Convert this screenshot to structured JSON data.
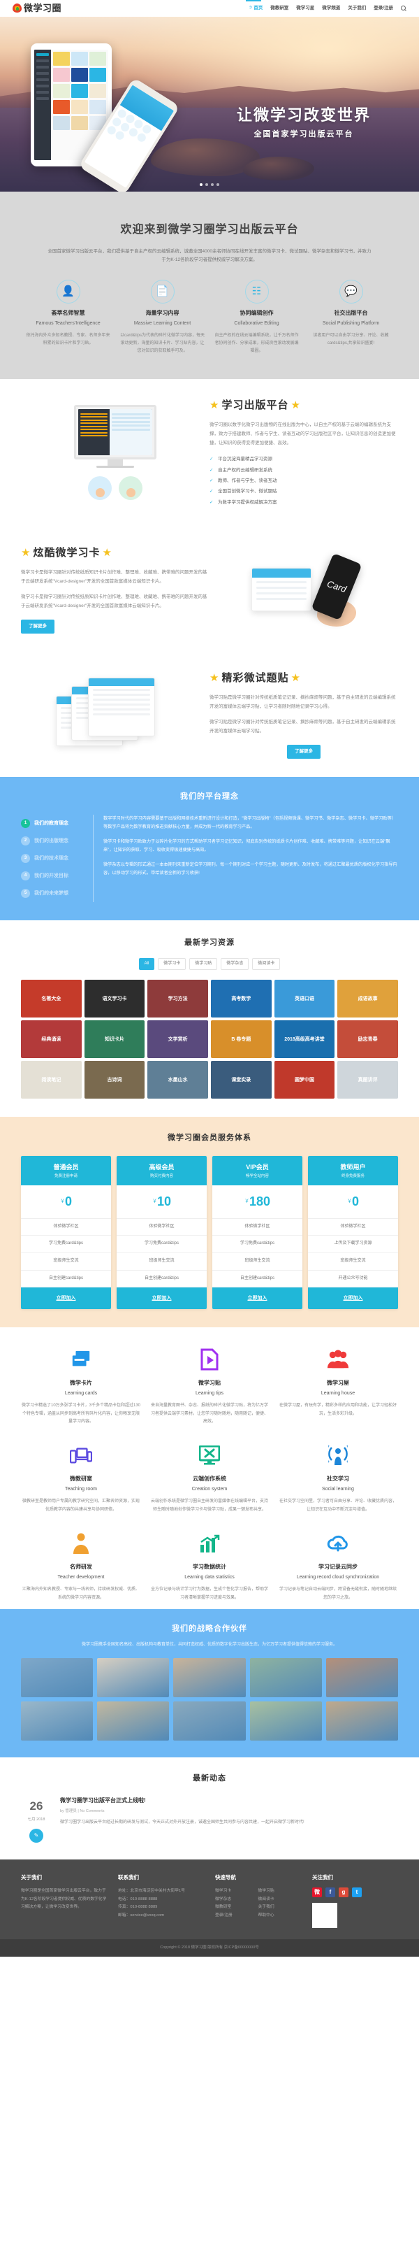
{
  "site": {
    "logo_text": "微学习圈"
  },
  "nav": {
    "items": [
      {
        "label": "首页",
        "active": true
      },
      {
        "label": "微教研室",
        "active": false
      },
      {
        "label": "微学习星",
        "active": false
      },
      {
        "label": "微学频道",
        "active": false
      },
      {
        "label": "关于我们",
        "active": false
      },
      {
        "label": "登录/注册",
        "active": false
      }
    ],
    "search_icon": "search-icon"
  },
  "hero": {
    "title": "让微学习改变世界",
    "subtitle": "全国首家学习出版云平台",
    "slides": 4,
    "active_slide": 1
  },
  "welcome": {
    "title": "欢迎来到微学习圈学习出版云平台",
    "desc": "全国首家微学习出版云平台，我们提供基于自主产权的云编辑系统，诚邀全国4000余名师协同在线开发丰富的微学习卡、微试题贴、微学杂志和微学习书，并致力于为K-12各阶段学习者提供权威学习解决方案。",
    "features": [
      {
        "icon": "user-icon",
        "title": "荟萃名师智慧",
        "en": "Famous Teachers'Intelligence",
        "desc": "依托海内外众多知名教授、专家、名师多年来积累的知识卡片和学习贴。"
      },
      {
        "icon": "cards-icon",
        "title": "海量学习内容",
        "en": "Massive Learning Content",
        "desc": "以card&tips为代表的碎片化微学习内容，每天滚动更新，海量的知识卡片、学习贴内容，让您对知识的获取触手可及。"
      },
      {
        "icon": "sitemap-icon",
        "title": "协同编辑创作",
        "en": "Collaborative Editing",
        "desc": "自主产权的在线云端编辑系统，让千万名师作者协同创作、分享成果，形成良性滚动发展编辑圈。"
      },
      {
        "icon": "comments-icon",
        "title": "社交出版平台",
        "en": "Social Publishing Platform",
        "desc": "读者用户可以自由学习分享、评论、收藏cards&tips,共享知识盛宴!"
      }
    ]
  },
  "platform": {
    "title": "学习出版平台",
    "desc": "微学习圈以数字化微学习出版物的在线出版为中心，以自主产权的基于云端的编辑系统为支撑，致力于搭建教师、作者与学生、读者互动的学习出版社区平台，让知识信息的创造更加便捷，让知识的获得变得更加便捷、高效。",
    "checklist": [
      "平台沉淀海量精品学习资源",
      "自主产权的云编辑研发系统",
      "教师、作者与学生、读者互动",
      "全国首创微学习卡、微试题贴",
      "为数字学习提供权威解决方案"
    ]
  },
  "card_section": {
    "title": "炫酷微学习卡",
    "p1": "微学习卡是微学习圈针对传统纸质知识卡片创作难、整理难、收藏难、携带难的问题开发的基于云端研发系统\"Vcard-designer\"开发的全国首款富媒体云端知识卡片。",
    "p2": "微学习卡是微学习圈针对传统纸质知识卡片创作难、整理难、收藏难、携带难的问题开发的基于云端研发系统\"Vcard-designer\"开发的全国首款富媒体云端知识卡片。",
    "button": "了解更多",
    "art_label": "Card"
  },
  "tips_section": {
    "title": "精彩微试题贴",
    "p1": "微学习贴是微学习圈针对传统纸质笔记记录、摘抄麻烦等问题，基于自主研发的云端编辑系统开发的富媒体云端学习贴，让学习者随时随地记录学习心得。",
    "p2": "微学习贴是微学习圈针对传统纸质笔记记录、摘抄麻烦等问题，基于自主研发的云端编辑系统开发的富媒体云端学习贴。",
    "button": "了解更多"
  },
  "philosophy": {
    "title": "我们的平台理念",
    "tabs": [
      {
        "num": "1",
        "label": "我们的教育理念",
        "active": true
      },
      {
        "num": "2",
        "label": "我们的出版理念",
        "active": false
      },
      {
        "num": "3",
        "label": "我们的技术理念",
        "active": false
      },
      {
        "num": "4",
        "label": "我们的开发目标",
        "active": false
      },
      {
        "num": "5",
        "label": "我们的未来梦想",
        "active": false
      }
    ],
    "paragraphs": [
      "数字学习时代的学习内容需要基于出版和网络技术重新进行设计和打造，\"微学习出版物\"（包括视频微课、微学习书、微学杂志、微学习卡、微学习贴等）等数字产品将为数字教育的推进贡献核心力量，并成为新一代的教育学习产品。",
      "微学习卡和微学习贴致力于以碎片化学习的方式帮助学习者学习记忆知识，彻底告别传统的纸质卡片创作难、收藏难、携带难等问题，让知识在云端\"飘来\"，让知识的获取、学习、吸收变得极速便捷与高效。",
      "微学杂志以专辑的形式通过一本本期刊来重新定位学习期刊，每一个期刊对应一个学习主题，随时更新、及时发布，将通过汇聚最优质的版权化学习指导内容，以移动学习的形式，带给读者全新的学习收获!"
    ]
  },
  "resources": {
    "title": "最新学习资源",
    "tabs": [
      {
        "label": "All",
        "active": true
      },
      {
        "label": "微学习卡",
        "active": false
      },
      {
        "label": "微学习贴",
        "active": false
      },
      {
        "label": "微学杂志",
        "active": false
      },
      {
        "label": "微阅读卡",
        "active": false
      }
    ],
    "items": [
      {
        "label": "名著大全",
        "color": "#c53b2a"
      },
      {
        "label": "语文学习卡",
        "color": "#2d2d2d"
      },
      {
        "label": "学习方法",
        "color": "#8e3b3b"
      },
      {
        "label": "高考数学",
        "color": "#1f6fb2"
      },
      {
        "label": "英语口语",
        "color": "#3a9ad9"
      },
      {
        "label": "成语故事",
        "color": "#e0a13b"
      },
      {
        "label": "经典诵读",
        "color": "#b33a3a"
      },
      {
        "label": "知识卡片",
        "color": "#2f7d5a"
      },
      {
        "label": "文学赏析",
        "color": "#5a4a7d"
      },
      {
        "label": "B 卷专题",
        "color": "#d88f2a"
      },
      {
        "label": "2018高级高考讲堂",
        "color": "#1a6fae"
      },
      {
        "label": "励志青春",
        "color": "#c44d3a"
      },
      {
        "label": "阅读笔记",
        "color": "#e4e0d5"
      },
      {
        "label": "古诗词",
        "color": "#7a6a4f"
      },
      {
        "label": "水墨山水",
        "color": "#5f7f96"
      },
      {
        "label": "课堂实录",
        "color": "#3a5c7d"
      },
      {
        "label": "圆梦中国",
        "color": "#c0392b"
      },
      {
        "label": "真题讲评",
        "color": "#cfd6db"
      }
    ]
  },
  "membership": {
    "title": "微学习圈会员服务体系",
    "plans": [
      {
        "name": "普通会员",
        "sub": "免费注册申请",
        "currency": "￥",
        "price": "0",
        "features": [
          "体验微学社区",
          "学习免费card&tips",
          "班级师生交流",
          "自主创建card&tips"
        ],
        "cta": "立即加入"
      },
      {
        "name": "高级会员",
        "sub": "购买付费内容",
        "currency": "￥",
        "price": "10",
        "features": [
          "体验微学社区",
          "学习免费card&tips",
          "班级师生交流",
          "自主创建card&tips"
        ],
        "cta": "立即加入"
      },
      {
        "name": "VIP会员",
        "sub": "畅学全站内容",
        "currency": "￥",
        "price": "180",
        "features": [
          "体验微学社区",
          "学习免费card&tips",
          "班级师生交流",
          "自主创建card&tips"
        ],
        "cta": "立即加入"
      },
      {
        "name": "教师用户",
        "sub": "终身免费服务",
        "currency": "￥",
        "price": "0",
        "features": [
          "体验微学社区",
          "上传及下载学习资源",
          "班级师生交流",
          "开通公众号功能"
        ],
        "cta": "立即加入"
      }
    ]
  },
  "services": {
    "items": [
      {
        "icon": "cards-stack-icon",
        "color": "#2196e8",
        "title": "微学卡片",
        "en": "Learning cards",
        "desc": "微学习卡精选了10万多张学习卡片，3千多个精品卡包和超过130个特色专辑，涵盖从同步到高考所有碎片化内容，让你畅享无限量学习内容。"
      },
      {
        "icon": "play-document-icon",
        "color": "#a030f0",
        "title": "微学习贴",
        "en": "Learning tips",
        "desc": "来自海量教育图书、杂志、报纸的碎片化微学习贴，将为亿万学习者提供云端学习素材，让您学习随时随地，随用随记，便捷、高效。"
      },
      {
        "icon": "people-icon",
        "color": "#ef3a3a",
        "title": "微学习屋",
        "en": "Learning house",
        "desc": "在微学习屋，有玩有学，精彩多样的应用和功能，让学习轻松好玩，生活多彩升级。"
      },
      {
        "icon": "devices-icon",
        "color": "#5b4ae0",
        "title": "微教研室",
        "en": "Teaching room",
        "desc": "微教研室是教师用户专属的教学研究空间，汇聚名师资源，实现优质教学内容的共建共享与协同研修。"
      },
      {
        "icon": "tools-monitor-icon",
        "color": "#13b58a",
        "title": "云端创作系统",
        "en": "Creation system",
        "desc": "云端创作系统是微学习圈自主研发的富媒体在线编辑平台，支持师生随时随地创作微学习卡与微学习贴，成果一键发布共享。"
      },
      {
        "icon": "broadcast-icon",
        "color": "#1d86d8",
        "title": "社交学习",
        "en": "Social learning",
        "desc": "在社交学习空间里，学习者可自由分享、评论、收藏优质内容，让知识在互动中不断沉淀与增值。"
      },
      {
        "icon": "teacher-icon",
        "color": "#f0a030",
        "title": "名师研发",
        "en": "Teacher development",
        "desc": "汇聚海内外知名教授、专家与一线名师，持续研发权威、优质、系统的微学习内容资源。"
      },
      {
        "icon": "chart-icon",
        "color": "#13b58a",
        "title": "学习数据统计",
        "en": "Learning data statistics",
        "desc": "全方位记录与统计学习行为数据，生成个性化学习报告，帮助学习者清晰掌握学习进度与效果。"
      },
      {
        "icon": "cloud-sync-icon",
        "color": "#2196e8",
        "title": "学习记录云同步",
        "en": "Learning record cloud synchronization",
        "desc": "学习记录与笔记自动云端同步，跨设备无缝衔接，随时随地继续您的学习之旅。"
      }
    ]
  },
  "partners": {
    "title": "我们的战略合作伙伴",
    "desc": "微学习圈携手全国知名高校、出版机构与教育单位，共同打造权威、优质的数字化学习出版生态，为亿万学习者提供值得信赖的学习服务。",
    "cells": [
      {
        "name": "合作院校 1",
        "color": "#7fa8c9"
      },
      {
        "name": "合作院校 2",
        "color": "#d7cfc2"
      },
      {
        "name": "合作院校 3",
        "color": "#c9b49a"
      },
      {
        "name": "合作院校 4",
        "color": "#8fb3a0"
      },
      {
        "name": "合作院校 5",
        "color": "#b5907a"
      },
      {
        "name": "合作院校 6",
        "color": "#9ab7c9"
      },
      {
        "name": "合作院校 7",
        "color": "#c2b89f"
      },
      {
        "name": "合作院校 8",
        "color": "#8aa9bd"
      },
      {
        "name": "合作院校 9",
        "color": "#a8c0a0"
      },
      {
        "name": "合作院校 10",
        "color": "#bfa98c"
      }
    ]
  },
  "news": {
    "title": "最新动态",
    "items": [
      {
        "day": "26",
        "month": "七月 2018",
        "title": "微学习圈学习出版平台正式上线啦!",
        "meta": "by 管理员   |   No Comments",
        "body": "微学习圈学习出版云平台经过长期的研发与测试，今天正式对外开放注册，诚邀全国师生共同参与内容共建，一起开启微学习新时代!"
      }
    ]
  },
  "footer": {
    "cols": [
      {
        "title": "关于我们",
        "type": "text",
        "body": "微学习圈是全国首家微学习出版云平台，致力于为K-12各阶段学习者提供权威、优质的数字化学习解决方案，让微学习改变世界。"
      },
      {
        "title": "联系我们",
        "type": "text",
        "body": "地址：北京市海淀区中关村大街甲1号\n电话：010-8888 8888\n传真：010-8888 8889\n邮箱：service@vxxq.com"
      },
      {
        "title": "快速导航",
        "type": "links",
        "links": [
          "微学习卡",
          "微学习贴",
          "微学杂志",
          "微阅读卡",
          "微教研室",
          "关于我们",
          "登录/注册",
          "帮助中心"
        ]
      },
      {
        "title": "关注我们",
        "type": "social",
        "socials": [
          {
            "name": "weibo-icon",
            "glyph": "微",
            "color": "#e6162d"
          },
          {
            "name": "facebook-icon",
            "glyph": "f",
            "color": "#3b5998"
          },
          {
            "name": "google-plus-icon",
            "glyph": "g",
            "color": "#dd4b39"
          },
          {
            "name": "twitter-icon",
            "glyph": "t",
            "color": "#1da1f2"
          }
        ]
      }
    ],
    "copyright": "Copyright © 2018 微学习圈 版权所有  京ICP备00000000号"
  }
}
